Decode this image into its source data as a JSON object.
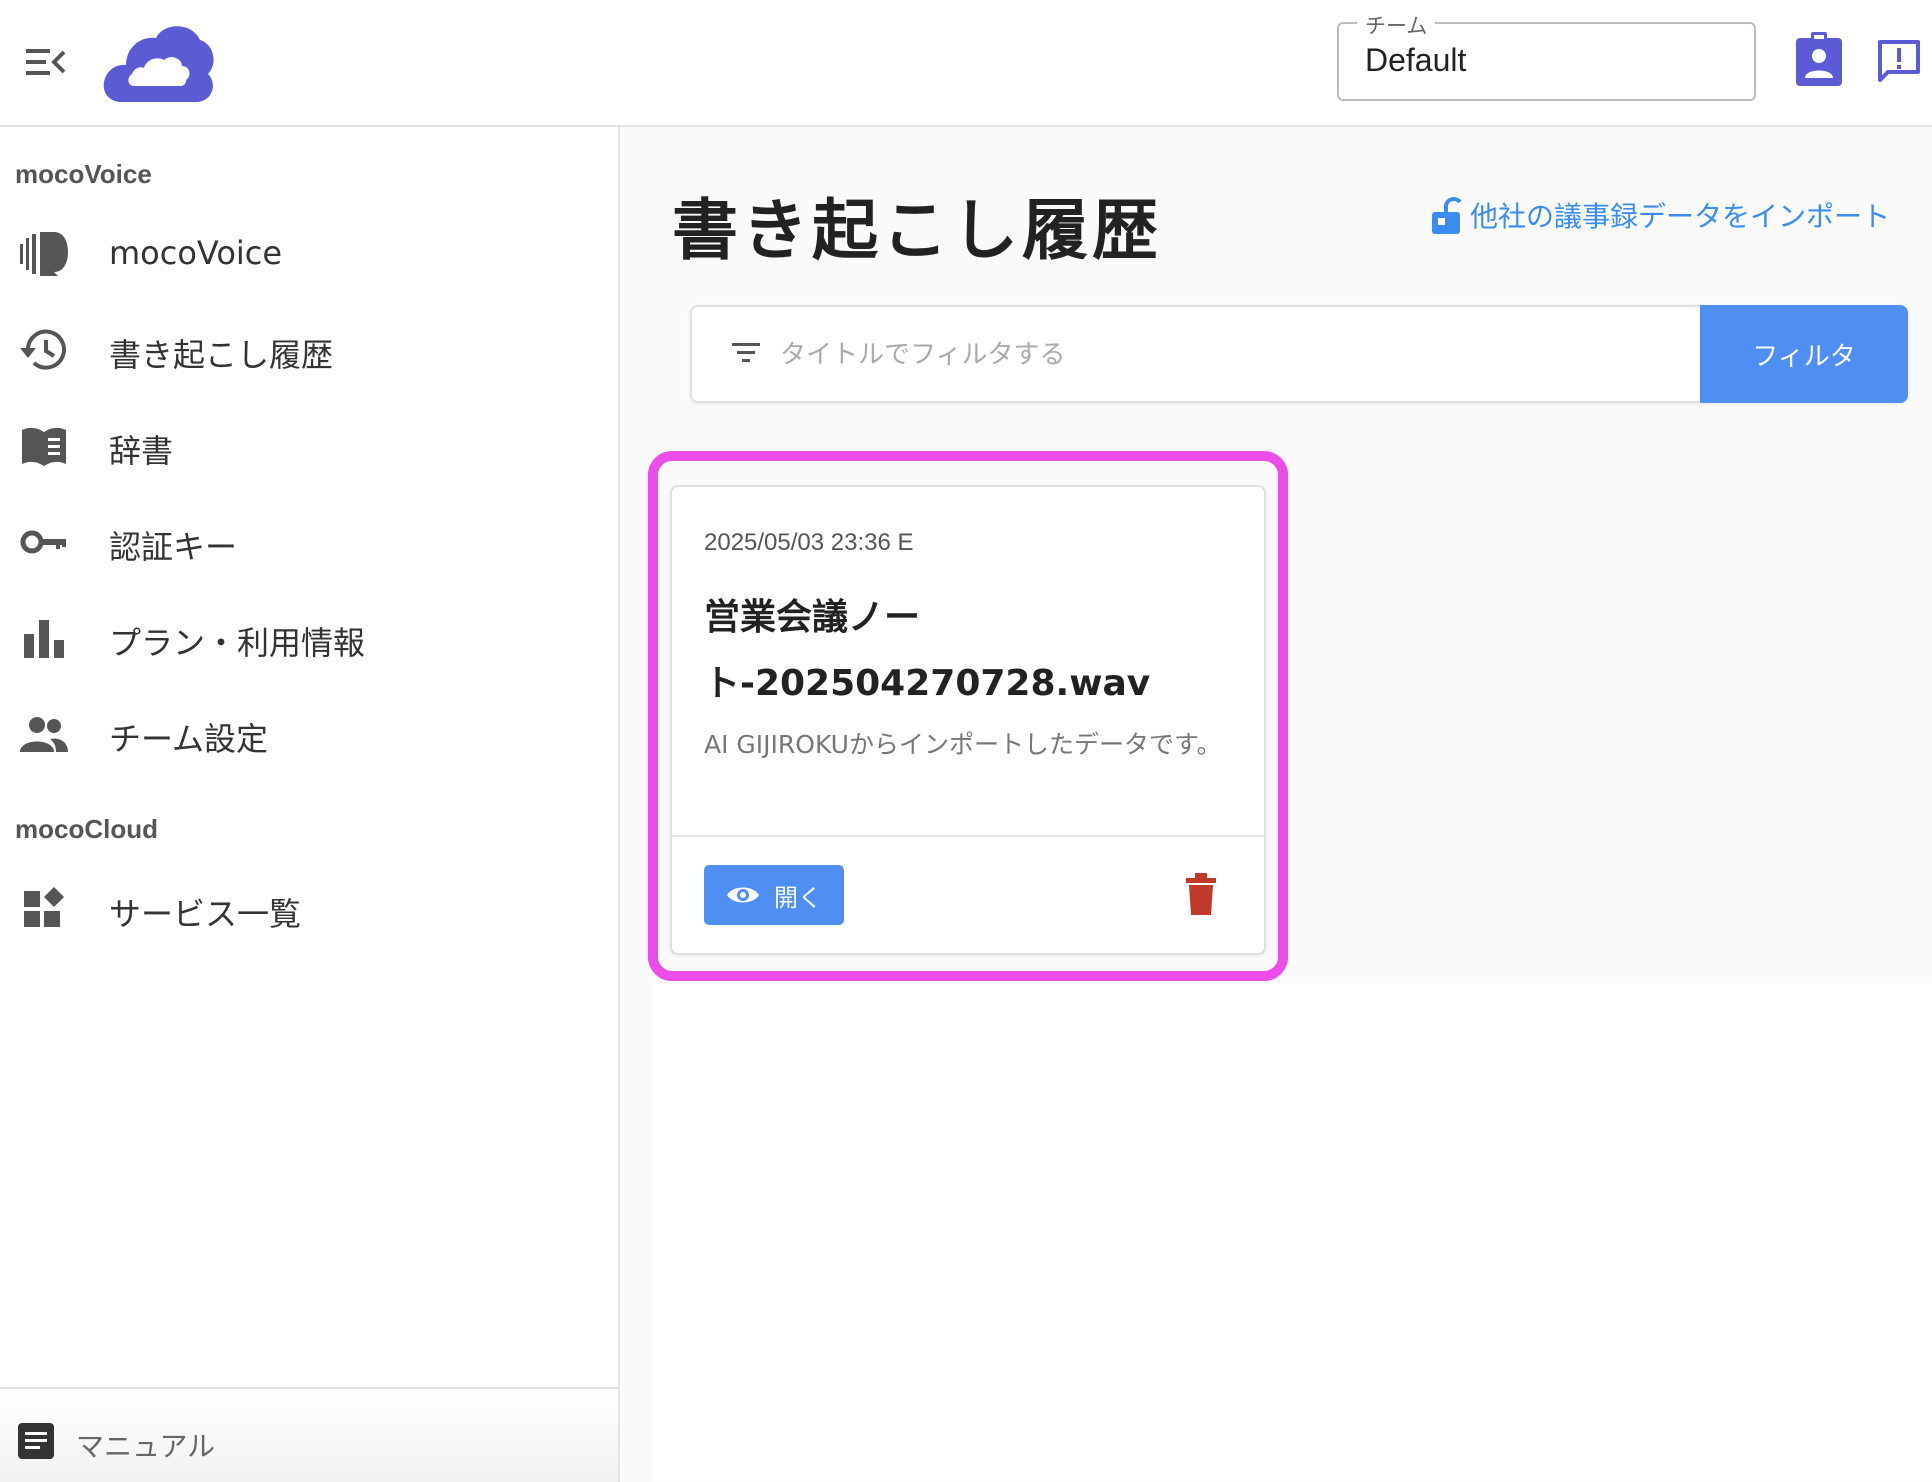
{
  "header": {
    "team_label": "チーム",
    "team_value": "Default"
  },
  "sidebar": {
    "sections": [
      {
        "label": "mocoVoice",
        "items": [
          {
            "label": "mocoVoice",
            "icon": "voice-icon"
          },
          {
            "label": "書き起こし履歴",
            "icon": "history-icon"
          },
          {
            "label": "辞書",
            "icon": "book-icon"
          },
          {
            "label": "認証キー",
            "icon": "key-icon"
          },
          {
            "label": "プラン・利用情報",
            "icon": "bar-chart-icon"
          },
          {
            "label": "チーム設定",
            "icon": "group-icon"
          }
        ]
      },
      {
        "label": "mocoCloud",
        "items": [
          {
            "label": "サービス一覧",
            "icon": "widgets-icon"
          }
        ]
      }
    ],
    "footer": {
      "label": "マニュアル",
      "icon": "document-icon"
    }
  },
  "main": {
    "title": "書き起こし履歴",
    "import_link": "他社の議事録データをインポート",
    "filter": {
      "placeholder": "タイトルでフィルタする",
      "button": "フィルタ"
    },
    "cards": [
      {
        "date": "2025/05/03 23:36 E",
        "title": "営業会議ノート-202504270728.wav",
        "description": "AI GIJIROKUからインポートしたデータです。",
        "open_label": "開く"
      }
    ]
  },
  "colors": {
    "brand": "#5b5bd6",
    "accent": "#4f8ff3",
    "link": "#3b8cf0",
    "delete": "#c0392b",
    "highlight": "#ec4de8"
  }
}
